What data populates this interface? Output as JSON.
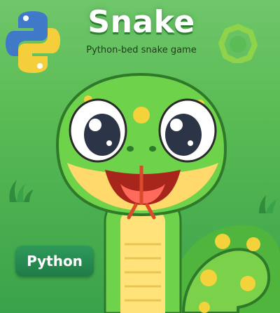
{
  "title": "Snake",
  "subtitle": "Python-bed snake game",
  "badge_label": "Python",
  "icons": {
    "python_logo": "python-logo-icon",
    "ring": "ring-icon",
    "grass": "grass-icon",
    "mascot": "snake-mascot"
  },
  "colors": {
    "background": "#5bbc55",
    "snake_green": "#6fd24b",
    "snake_belly": "#ffe37a",
    "badge": "#1f7c47",
    "tongue": "#d84a2a"
  }
}
